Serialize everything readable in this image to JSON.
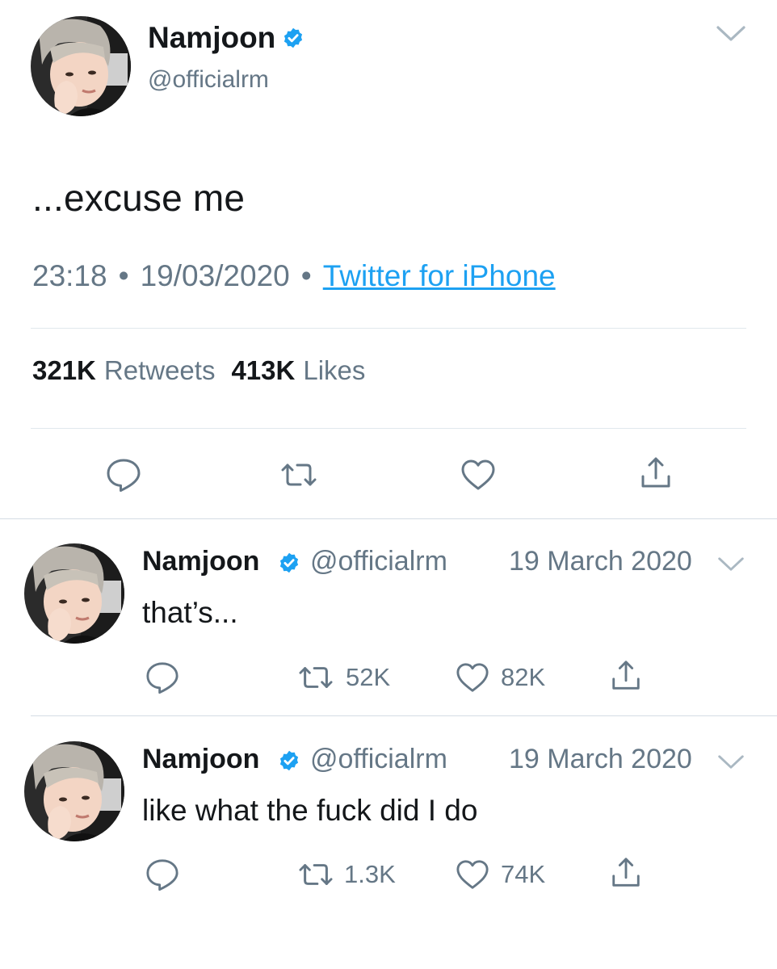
{
  "main_tweet": {
    "name": "Namjoon",
    "handle": "@officialrm",
    "avatar": "avatar-photo",
    "verified_icon": "verified-badge-icon",
    "menu_icon": "chevron-down-icon",
    "text": "...excuse me",
    "time": "23:18",
    "separator": "•",
    "date": "19/03/2020",
    "source": "Twitter for iPhone",
    "retweets_count": "321K",
    "retweets_label": "Retweets",
    "likes_count": "413K",
    "likes_label": "Likes",
    "actions": [
      "reply-icon",
      "retweet-icon",
      "like-icon",
      "share-icon"
    ]
  },
  "replies": [
    {
      "name": "Namjoon",
      "handle": "@officialrm",
      "date": "19 March 2020",
      "text": "that’s...",
      "retweets": "52K",
      "likes": "82K"
    },
    {
      "name": "Namjoon",
      "handle": "@officialrm",
      "date": "19 March 2020",
      "text": "like what the fuck did I do",
      "retweets": "1.3K",
      "likes": "74K"
    }
  ],
  "colors": {
    "accent": "#1da1f2",
    "text": "#14171a",
    "secondary": "#657786",
    "icon": "#657786",
    "divider": "#e1e8ed"
  }
}
